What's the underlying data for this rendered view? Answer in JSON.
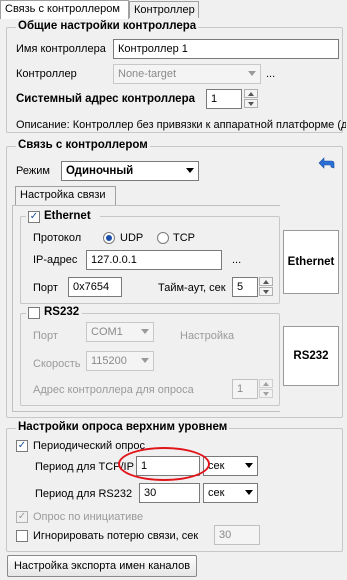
{
  "tabs": [
    "Связь с контроллером",
    "Контроллер"
  ],
  "general": {
    "title": "Общие настройки контроллера",
    "name_label": "Имя контроллера",
    "name_value": "Контроллер 1",
    "controller_label": "Контроллер",
    "controller_value": "None-target",
    "ellipsis": "...",
    "sysaddr_label": "Системный адрес контроллера",
    "sysaddr_value": "1",
    "description": "Описание: Контроллер без привязки к аппаратной платформе (д"
  },
  "conn": {
    "title": "Связь с контроллером",
    "mode_label": "Режим",
    "mode_value": "Одиночный",
    "tab_label": "Настройка связи",
    "ethernet": {
      "title": "Ethernet",
      "checked": true,
      "protocol_label": "Протокол",
      "udp": "UDP",
      "tcp": "TCP",
      "ip_label": "IP-адрес",
      "ip_value": "127.0.0.1",
      "ellipsis": "...",
      "port_label": "Порт",
      "port_value": "0x7654",
      "timeout_label": "Тайм-аут, сек",
      "timeout_value": "5",
      "button": "Ethernet"
    },
    "rs232": {
      "title": "RS232",
      "checked": false,
      "port_label": "Порт",
      "port_value": "COM1",
      "settings_label": "Настройка",
      "speed_label": "Скорость",
      "speed_value": "115200",
      "addr_label": "Адрес контроллера для опроса",
      "addr_value": "1",
      "button": "RS232"
    }
  },
  "poll": {
    "title": "Настройки опроса верхним уровнем",
    "periodic_label": "Периодический опрос",
    "tcpip_label": "Период для TCP/IP",
    "tcpip_value": "1",
    "tcpip_unit": "сек",
    "rs232_label": "Период для RS232",
    "rs232_value": "30",
    "rs232_unit": "сек",
    "initiative_label": "Опрос по инициативе",
    "ignore_label": "Игнорировать потерю связи, сек",
    "ignore_value": "30"
  },
  "export_button": "Настройка экспорта имен каналов",
  "check_mark": "✓",
  "colors": {
    "annotation": "#e0141a",
    "accent": "#1b4ea8"
  }
}
